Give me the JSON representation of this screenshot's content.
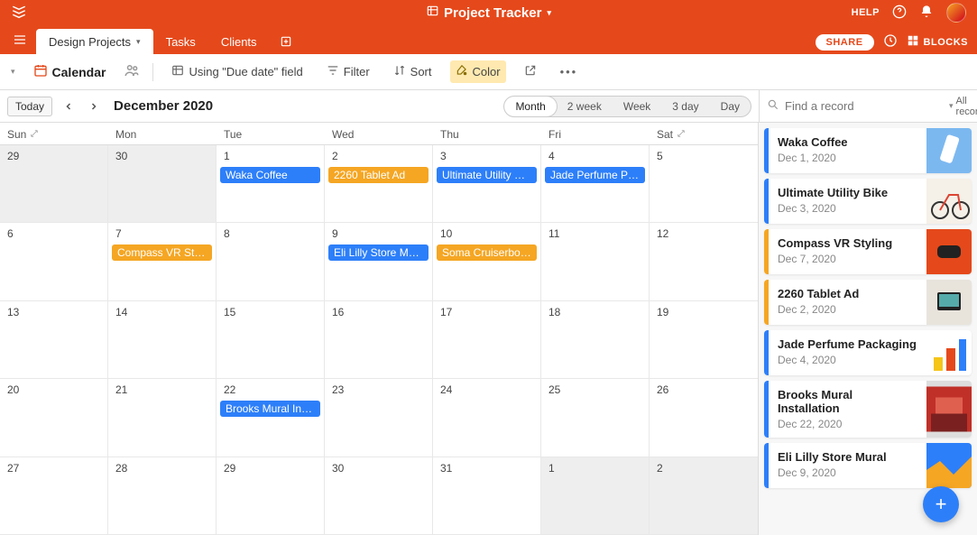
{
  "header": {
    "base_title": "Project Tracker",
    "help_label": "HELP"
  },
  "tabs": {
    "items": [
      {
        "label": "Design Projects",
        "active": true
      },
      {
        "label": "Tasks",
        "active": false
      },
      {
        "label": "Clients",
        "active": false
      }
    ],
    "share_label": "SHARE",
    "blocks_label": "BLOCKS"
  },
  "toolbar": {
    "view_name": "Calendar",
    "using_label": "Using \"Due date\" field",
    "filter_label": "Filter",
    "sort_label": "Sort",
    "color_label": "Color"
  },
  "controls": {
    "today_label": "Today",
    "month_header": "December 2020",
    "range_options": [
      "Month",
      "2 week",
      "Week",
      "3 day",
      "Day"
    ],
    "range_active": "Month"
  },
  "side_search": {
    "placeholder": "Find a record",
    "all_records_label": "All records"
  },
  "calendar": {
    "day_names": [
      "Sun",
      "Mon",
      "Tue",
      "Wed",
      "Thu",
      "Fri",
      "Sat"
    ],
    "cells": [
      {
        "num": "29",
        "other": true
      },
      {
        "num": "30",
        "other": true
      },
      {
        "num": "1",
        "events": [
          {
            "t": "Waka Coffee",
            "c": "blue"
          }
        ]
      },
      {
        "num": "2",
        "events": [
          {
            "t": "2260 Tablet Ad",
            "c": "orange"
          }
        ]
      },
      {
        "num": "3",
        "events": [
          {
            "t": "Ultimate Utility Bike",
            "c": "blue"
          }
        ]
      },
      {
        "num": "4",
        "events": [
          {
            "t": "Jade Perfume Pac…",
            "c": "blue"
          }
        ]
      },
      {
        "num": "5"
      },
      {
        "num": "6"
      },
      {
        "num": "7",
        "events": [
          {
            "t": "Compass VR Styli…",
            "c": "orange"
          }
        ]
      },
      {
        "num": "8"
      },
      {
        "num": "9",
        "events": [
          {
            "t": "Eli Lilly Store Mural",
            "c": "blue"
          }
        ]
      },
      {
        "num": "10",
        "events": [
          {
            "t": "Soma Cruiserboard",
            "c": "orange"
          }
        ]
      },
      {
        "num": "11"
      },
      {
        "num": "12"
      },
      {
        "num": "13"
      },
      {
        "num": "14"
      },
      {
        "num": "15"
      },
      {
        "num": "16"
      },
      {
        "num": "17"
      },
      {
        "num": "18"
      },
      {
        "num": "19"
      },
      {
        "num": "20"
      },
      {
        "num": "21"
      },
      {
        "num": "22",
        "events": [
          {
            "t": "Brooks Mural Inst…",
            "c": "blue"
          }
        ]
      },
      {
        "num": "23"
      },
      {
        "num": "24"
      },
      {
        "num": "25"
      },
      {
        "num": "26"
      },
      {
        "num": "27"
      },
      {
        "num": "28"
      },
      {
        "num": "29"
      },
      {
        "num": "30"
      },
      {
        "num": "31"
      },
      {
        "num": "1",
        "other": true
      },
      {
        "num": "2",
        "other": true
      }
    ]
  },
  "records": [
    {
      "title": "Waka Coffee",
      "date": "Dec 1, 2020",
      "stripe": "blue",
      "thumb": "phone"
    },
    {
      "title": "Ultimate Utility Bike",
      "date": "Dec 3, 2020",
      "stripe": "blue",
      "thumb": "bike"
    },
    {
      "title": "Compass VR Styling",
      "date": "Dec 7, 2020",
      "stripe": "orange",
      "thumb": "vr"
    },
    {
      "title": "2260 Tablet Ad",
      "date": "Dec 2, 2020",
      "stripe": "orange",
      "thumb": "tablet"
    },
    {
      "title": "Jade Perfume Packaging",
      "date": "Dec 4, 2020",
      "stripe": "blue",
      "thumb": "perfume"
    },
    {
      "title": "Brooks Mural Installation",
      "date": "Dec 22, 2020",
      "stripe": "blue",
      "thumb": "mural"
    },
    {
      "title": "Eli Lilly Store Mural",
      "date": "Dec 9, 2020",
      "stripe": "blue",
      "thumb": "store"
    }
  ]
}
